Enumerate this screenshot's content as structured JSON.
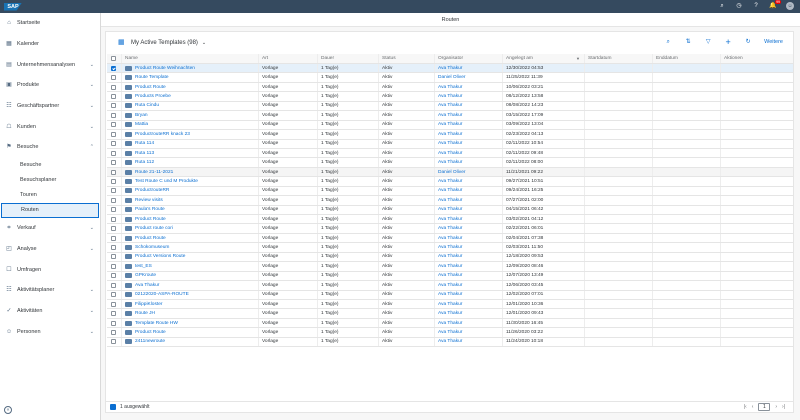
{
  "shell": {
    "logo": "SAP",
    "notifications_count": "99",
    "icons": [
      "search-icon",
      "history-icon",
      "help-icon",
      "notifications-icon",
      "user-avatar"
    ]
  },
  "title": "Routen",
  "sidebar": {
    "items": [
      {
        "label": "Startseite",
        "icon": "home-icon",
        "chevron": false
      },
      {
        "label": "Kalender",
        "icon": "calendar-icon",
        "chevron": false
      },
      {
        "label": "Unternehmensanalysen",
        "icon": "analytics-icon",
        "chevron": true
      },
      {
        "label": "Produkte",
        "icon": "product-icon",
        "chevron": true
      },
      {
        "label": "Geschäftspartner",
        "icon": "partner-icon",
        "chevron": true
      },
      {
        "label": "Kunden",
        "icon": "customer-icon",
        "chevron": true
      },
      {
        "label": "Besuche",
        "icon": "visit-icon",
        "chevron": true
      }
    ],
    "sub_items": [
      {
        "label": "Besuche",
        "active": false
      },
      {
        "label": "Besuchsplaner",
        "active": false
      },
      {
        "label": "Touren",
        "active": false
      },
      {
        "label": "Routen",
        "active": true
      }
    ],
    "items_after": [
      {
        "label": "Verkauf",
        "icon": "sales-icon",
        "chevron": true
      },
      {
        "label": "Analyse",
        "icon": "analysis-icon",
        "chevron": true
      },
      {
        "label": "Umfragen",
        "icon": "survey-icon",
        "chevron": false
      },
      {
        "label": "Aktivitätsplaner",
        "icon": "activity-planner-icon",
        "chevron": true
      },
      {
        "label": "Aktivitäten",
        "icon": "activities-icon",
        "chevron": true
      },
      {
        "label": "Personen",
        "icon": "person-icon",
        "chevron": true
      }
    ]
  },
  "toolbar": {
    "variant_title": "My Active Templates",
    "count": "(98)",
    "more_label": "Weitere"
  },
  "table": {
    "headers": [
      "Name",
      "Art",
      "Dauer",
      "Status",
      "Organisator",
      "Angelegt am",
      "Startdatum",
      "Enddatum",
      "Aktionen"
    ],
    "rows": [
      {
        "name": "Product Route Weihnachten",
        "art": "Vorlage",
        "dauer": "1 Tag(e)",
        "status": "Aktiv",
        "organisator": "Ava Thakur",
        "angelegt": "12/30/2022 04:53",
        "selected": true
      },
      {
        "name": "Route Template",
        "art": "Vorlage",
        "dauer": "1 Tag(e)",
        "status": "Aktiv",
        "organisator": "Daniel Oliver",
        "angelegt": "11/25/2022 11:39"
      },
      {
        "name": "Product Route",
        "art": "Vorlage",
        "dauer": "1 Tag(e)",
        "status": "Aktiv",
        "organisator": "Ava Thakur",
        "angelegt": "10/06/2022 03:21"
      },
      {
        "name": "Products Proebe",
        "art": "Vorlage",
        "dauer": "1 Tag(e)",
        "status": "Aktiv",
        "organisator": "Ava Thakur",
        "angelegt": "08/12/2022 13:58"
      },
      {
        "name": "Ruta Cindu",
        "art": "Vorlage",
        "dauer": "1 Tag(e)",
        "status": "Aktiv",
        "organisator": "Ava Thakur",
        "angelegt": "08/08/2022 14:23"
      },
      {
        "name": "Bryan",
        "art": "Vorlage",
        "dauer": "1 Tag(e)",
        "status": "Aktiv",
        "organisator": "Ava Thakur",
        "angelegt": "03/15/2022 17:09"
      },
      {
        "name": "Mattia",
        "art": "Vorlage",
        "dauer": "1 Tag(e)",
        "status": "Aktiv",
        "organisator": "Ava Thakur",
        "angelegt": "03/09/2022 13:04"
      },
      {
        "name": "ProductrouteRR knack 23",
        "art": "Vorlage",
        "dauer": "1 Tag(e)",
        "status": "Aktiv",
        "organisator": "Ava Thakur",
        "angelegt": "02/23/2022 04:13"
      },
      {
        "name": "Ruta 114",
        "art": "Vorlage",
        "dauer": "1 Tag(e)",
        "status": "Aktiv",
        "organisator": "Ava Thakur",
        "angelegt": "02/11/2022 10:54"
      },
      {
        "name": "Ruta 113",
        "art": "Vorlage",
        "dauer": "1 Tag(e)",
        "status": "Aktiv",
        "organisator": "Ava Thakur",
        "angelegt": "02/11/2022 09:48"
      },
      {
        "name": "Ruta 112",
        "art": "Vorlage",
        "dauer": "1 Tag(e)",
        "status": "Aktiv",
        "organisator": "Ava Thakur",
        "angelegt": "02/11/2022 08:00"
      },
      {
        "name": "Route 21-11-2021",
        "art": "Vorlage",
        "dauer": "1 Tag(e)",
        "status": "Aktiv",
        "organisator": "Daniel Oliver",
        "angelegt": "11/21/2021 09:22",
        "alt": true
      },
      {
        "name": "Test Route C und M Produkte",
        "art": "Vorlage",
        "dauer": "1 Tag(e)",
        "status": "Aktiv",
        "organisator": "Ava Thakur",
        "angelegt": "09/27/2021 10:51"
      },
      {
        "name": "ProductrouteRR",
        "art": "Vorlage",
        "dauer": "1 Tag(e)",
        "status": "Aktiv",
        "organisator": "Ava Thakur",
        "angelegt": "09/24/2021 16:25"
      },
      {
        "name": "Review visits",
        "art": "Vorlage",
        "dauer": "1 Tag(e)",
        "status": "Aktiv",
        "organisator": "Ava Thakur",
        "angelegt": "07/27/2021 02:00"
      },
      {
        "name": "Paula's Route",
        "art": "Vorlage",
        "dauer": "1 Tag(e)",
        "status": "Aktiv",
        "organisator": "Ava Thakur",
        "angelegt": "04/15/2021 06:42"
      },
      {
        "name": "Product Route",
        "art": "Vorlage",
        "dauer": "1 Tag(e)",
        "status": "Aktiv",
        "organisator": "Ava Thakur",
        "angelegt": "03/02/2021 04:12"
      },
      {
        "name": "Product route cori",
        "art": "Vorlage",
        "dauer": "1 Tag(e)",
        "status": "Aktiv",
        "organisator": "Ava Thakur",
        "angelegt": "02/22/2021 06:01"
      },
      {
        "name": "Product Route",
        "art": "Vorlage",
        "dauer": "1 Tag(e)",
        "status": "Aktiv",
        "organisator": "Ava Thakur",
        "angelegt": "02/04/2021 07:38"
      },
      {
        "name": "Schokomuseum",
        "art": "Vorlage",
        "dauer": "1 Tag(e)",
        "status": "Aktiv",
        "organisator": "Ava Thakur",
        "angelegt": "02/03/2021 11:50"
      },
      {
        "name": "Product Versions Route",
        "art": "Vorlage",
        "dauer": "1 Tag(e)",
        "status": "Aktiv",
        "organisator": "Ava Thakur",
        "angelegt": "12/18/2020 09:53"
      },
      {
        "name": "test_ES",
        "art": "Vorlage",
        "dauer": "1 Tag(e)",
        "status": "Aktiv",
        "organisator": "Ava Thakur",
        "angelegt": "12/09/2020 08:46"
      },
      {
        "name": "GPKroute",
        "art": "Vorlage",
        "dauer": "1 Tag(e)",
        "status": "Aktiv",
        "organisator": "Ava Thakur",
        "angelegt": "12/07/2020 13:49"
      },
      {
        "name": "Ava Thakur",
        "art": "Vorlage",
        "dauer": "1 Tag(e)",
        "status": "Aktiv",
        "organisator": "Ava Thakur",
        "angelegt": "12/06/2020 03:45"
      },
      {
        "name": "02122020-ASPA-ROUTE",
        "art": "Vorlage",
        "dauer": "1 Tag(e)",
        "status": "Aktiv",
        "organisator": "Ava Thakur",
        "angelegt": "12/02/2020 07:01"
      },
      {
        "name": "FilippiKloster",
        "art": "Vorlage",
        "dauer": "1 Tag(e)",
        "status": "Aktiv",
        "organisator": "Ava Thakur",
        "angelegt": "12/01/2020 10:36"
      },
      {
        "name": "Route JH",
        "art": "Vorlage",
        "dauer": "1 Tag(e)",
        "status": "Aktiv",
        "organisator": "Ava Thakur",
        "angelegt": "12/01/2020 09:43"
      },
      {
        "name": "Template Route HW",
        "art": "Vorlage",
        "dauer": "1 Tag(e)",
        "status": "Aktiv",
        "organisator": "Ava Thakur",
        "angelegt": "11/30/2020 16:45"
      },
      {
        "name": "Product Route",
        "art": "Vorlage",
        "dauer": "1 Tag(e)",
        "status": "Aktiv",
        "organisator": "Ava Thakur",
        "angelegt": "11/26/2020 03:22"
      },
      {
        "name": "2411newroute",
        "art": "Vorlage",
        "dauer": "1 Tag(e)",
        "status": "Aktiv",
        "organisator": "Ava Thakur",
        "angelegt": "11/24/2020 10:18"
      }
    ]
  },
  "footer": {
    "selected_text": "1 ausgewählt",
    "page": "1"
  }
}
